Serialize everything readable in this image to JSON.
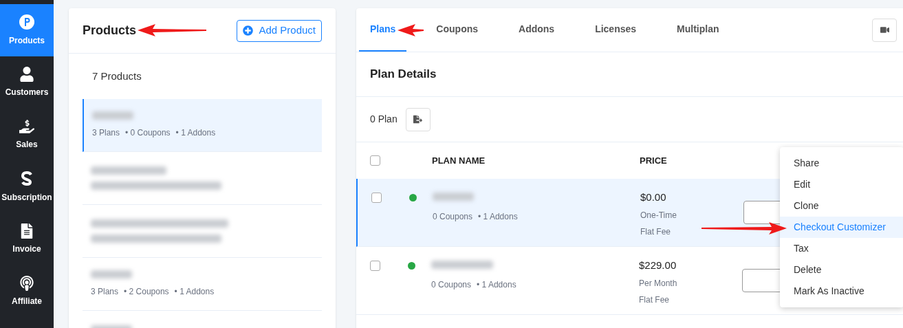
{
  "nav": [
    {
      "label": "Products",
      "kind": "product",
      "selected": true
    },
    {
      "label": "Customers",
      "kind": "user",
      "selected": false
    },
    {
      "label": "Sales",
      "kind": "sales",
      "selected": false
    },
    {
      "label": "Subscription",
      "kind": "subscription",
      "selected": false
    },
    {
      "label": "Invoice",
      "kind": "invoice",
      "selected": false
    },
    {
      "label": "Affiliate",
      "kind": "affiliate",
      "selected": false
    }
  ],
  "products_panel": {
    "title": "Products",
    "add_button": "Add Product",
    "count": "7 Products",
    "items": [
      {
        "selected": true,
        "stats": [
          "3 Plans",
          "• 0 Coupons",
          "• 1 Addons"
        ]
      },
      {
        "selected": false
      },
      {
        "selected": false
      },
      {
        "selected": false,
        "stats": [
          "3 Plans",
          "• 2 Coupons",
          "• 1 Addons"
        ]
      },
      {
        "selected": false
      }
    ]
  },
  "tabs": [
    {
      "label": "Plans",
      "selected": true
    },
    {
      "label": "Coupons",
      "selected": false
    },
    {
      "label": "Addons",
      "selected": false
    },
    {
      "label": "Licenses",
      "selected": false
    },
    {
      "label": "Multiplan",
      "selected": false
    }
  ],
  "plan_details": {
    "title": "Plan Details",
    "count": "0 Plan",
    "all_checked": false,
    "columns": [
      "PLAN NAME",
      "PRICE"
    ],
    "rows": [
      {
        "selected": true,
        "checked": false,
        "color": "#28a745",
        "stats": [
          "0 Coupons",
          "• 1 Addons"
        ],
        "price": "$0.00",
        "billing": "One-Time",
        "fee": "Flat Fee"
      },
      {
        "selected": false,
        "checked": false,
        "color": "#28a745",
        "stats": [
          "0 Coupons",
          "• 1 Addons"
        ],
        "price": "$229.00",
        "billing": "Per Month",
        "fee": "Flat Fee"
      }
    ]
  },
  "menu": [
    {
      "label": "Share",
      "selected": false
    },
    {
      "label": "Edit",
      "selected": false
    },
    {
      "label": "Clone",
      "selected": false
    },
    {
      "label": "Checkout Customizer",
      "selected": true
    },
    {
      "label": "Tax",
      "selected": false
    },
    {
      "label": "Delete",
      "selected": false
    },
    {
      "label": "Mark As Inactive",
      "selected": false
    }
  ]
}
